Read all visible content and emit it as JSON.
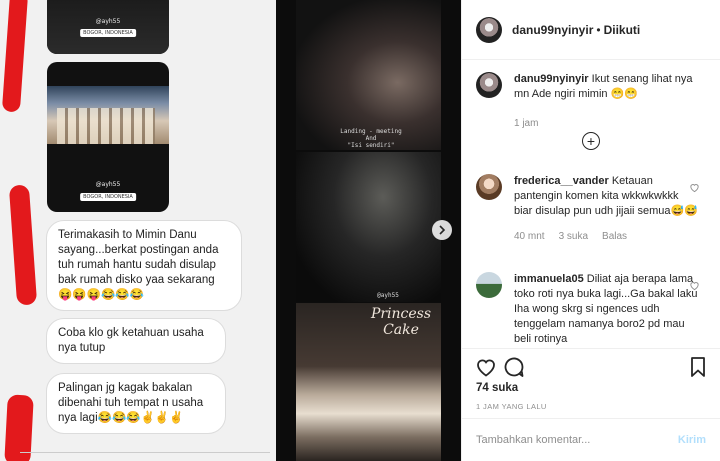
{
  "post": {
    "username": "danu99nyinyir",
    "separator": "•",
    "follow_status": "Diikuti"
  },
  "media": {
    "chat_messages": [
      "Terimakasih to Mimin Danu sayang...berkat postingan anda tuh rumah hantu sudah disulap bak rumah disko yaa sekarang 😝😝😝😂😂😂",
      "Coba klo gk ketahuan usaha nya tutup",
      "Palingan jg kagak bakalan dibenahi tuh tempat n usaha nya lagi😂😂😂✌✌✌"
    ],
    "story_tags": [
      "@ayh55",
      "@ayh55"
    ],
    "story_locations": [
      "BOGOR, INDONESIA",
      "BOGOR, INDONESIA"
    ],
    "photo_caption_top": "Landing - meeting\nAnd\n\"Isi sendiri\"",
    "photo_tag": "@ayh55",
    "photo_sign": "Princess\nCake"
  },
  "comments": [
    {
      "username": "danu99nyinyir",
      "text": "Ikut senang lihat nya mn Ade ngiri mimin 😁😁",
      "time": "1 jam",
      "likes": "",
      "reply": ""
    },
    {
      "username": "frederica__vander",
      "text": "Ketauan pantengin komen kita wkkwkwkkk biar disulap pun udh jijaii semua😅😅",
      "time": "40 mnt",
      "likes": "3 suka",
      "reply": "Balas"
    },
    {
      "username": "immanuela05",
      "text": "Diliat aja berapa lama toko roti nya buka lagi...Ga bakal laku Iha wong skrg si ngences udh tenggelam namanya boro2 pd mau beli rotinya",
      "time": "",
      "likes": "",
      "reply": ""
    }
  ],
  "actions": {
    "likes_text": "74 suka",
    "date_text": "1 JAM YANG LALU"
  },
  "comment_box": {
    "placeholder": "Tambahkan komentar...",
    "send_label": "Kirim"
  },
  "colors": {
    "accent": "#0095f6",
    "send_disabled": "#b2dffc",
    "mark_red": "#e3191c"
  },
  "icons": [
    "heart-icon",
    "comment-icon",
    "bookmark-icon",
    "plus-circle-icon",
    "chevron-right-icon"
  ]
}
